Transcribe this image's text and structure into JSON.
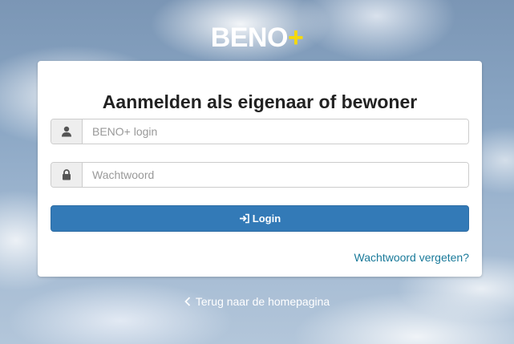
{
  "brand": {
    "name": "BENO",
    "plus": "+",
    "plus_color": "#f5d90a"
  },
  "login_card": {
    "title": "Aanmelden als eigenaar of bewoner",
    "login_field": {
      "icon": "user-icon",
      "placeholder": "BENO+ login",
      "value": ""
    },
    "password_field": {
      "icon": "lock-icon",
      "placeholder": "Wachtwoord",
      "value": ""
    },
    "login_button": {
      "icon": "sign-in-icon",
      "label": "Login",
      "color": "#337ab7"
    },
    "forgot_password_link": "Wachtwoord vergeten?"
  },
  "back_link": {
    "icon": "chevron-left-icon",
    "label": "Terug naar de homepagina"
  }
}
